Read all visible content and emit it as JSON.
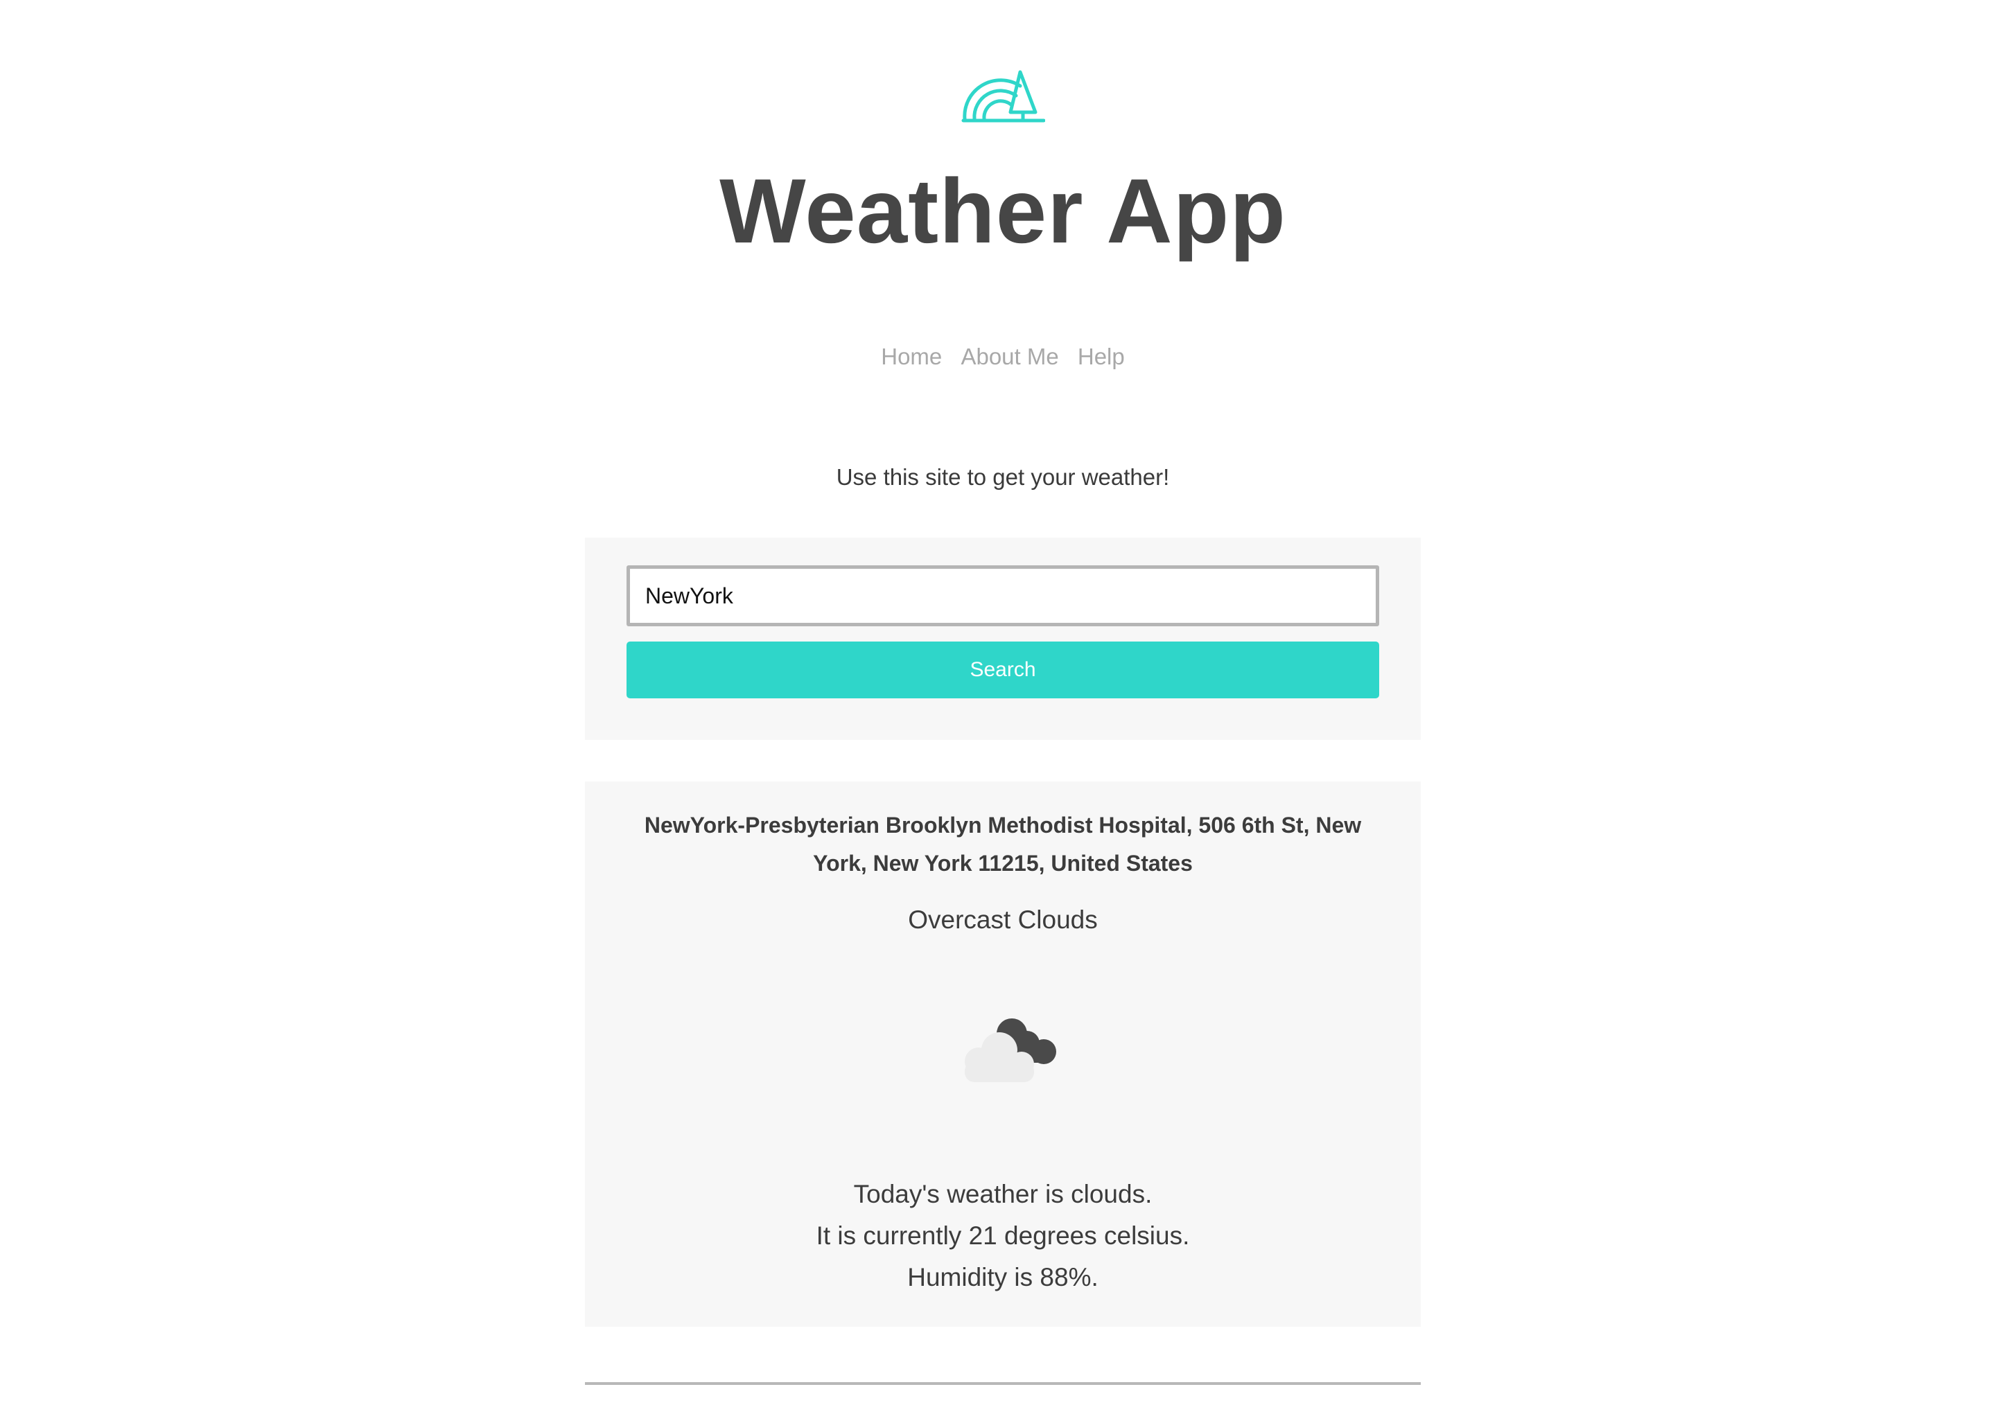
{
  "header": {
    "logo_icon": "rainbow-tree-icon",
    "title": "Weather App"
  },
  "nav": {
    "items": [
      {
        "label": "Home"
      },
      {
        "label": "About Me"
      },
      {
        "label": "Help"
      }
    ]
  },
  "intro": {
    "text": "Use this site to get your weather!"
  },
  "search": {
    "value": "NewYork",
    "button_label": "Search"
  },
  "result": {
    "location": "NewYork-Presbyterian Brooklyn Methodist Hospital, 506 6th St, New York, New York 11215, United States",
    "description": "Overcast Clouds",
    "icon": "overcast-clouds-icon",
    "summary": "Today's weather is clouds.",
    "temperature_text": "It is currently 21 degrees celsius.",
    "humidity_text": "Humidity is 88%."
  },
  "colors": {
    "accent": "#2fd6c9",
    "text": "#464646",
    "nav_text": "#a8a8a8",
    "card_background": "#f7f7f7"
  }
}
